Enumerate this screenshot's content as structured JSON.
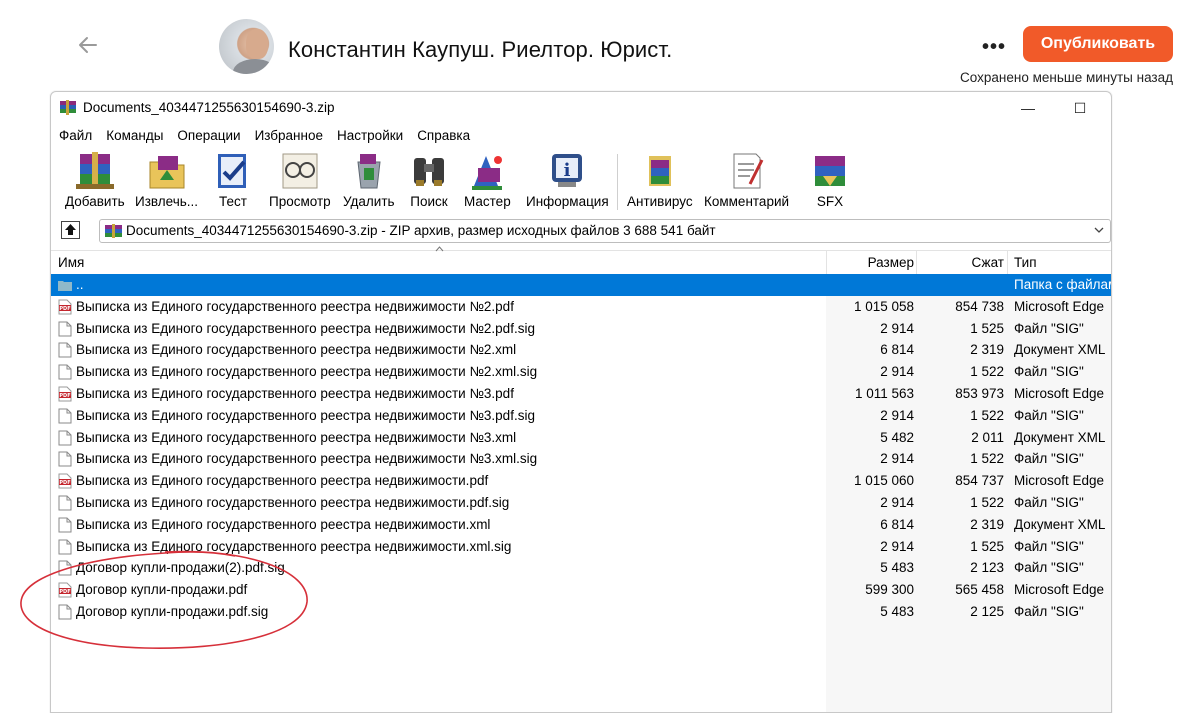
{
  "header": {
    "blog_title": "Константин Каупуш. Риелтор. Юрист.",
    "more_label": "•••",
    "publish_label": "Опубликовать",
    "saved_status": "Сохранено меньше минуты назад"
  },
  "window": {
    "title": "Documents_4034471255630154690-3.zip",
    "controls": {
      "minimize": "—",
      "maximize": "☐",
      "close": "✕"
    },
    "menu": [
      "Файл",
      "Команды",
      "Операции",
      "Избранное",
      "Настройки",
      "Справка"
    ],
    "toolbar": [
      {
        "label": "Добавить",
        "icon": "add-books-icon"
      },
      {
        "label": "Извлечь...",
        "icon": "extract-folder-icon"
      },
      {
        "label": "Тест",
        "icon": "test-check-icon"
      },
      {
        "label": "Просмотр",
        "icon": "view-glasses-icon"
      },
      {
        "label": "Удалить",
        "icon": "delete-recycle-icon"
      },
      {
        "label": "Поиск",
        "icon": "find-binoculars-icon"
      },
      {
        "label": "Мастер",
        "icon": "wizard-icon"
      },
      {
        "label": "Информация",
        "icon": "info-icon"
      },
      {
        "label": "Антивирус",
        "icon": "antivirus-icon"
      },
      {
        "label": "Комментарий",
        "icon": "comment-icon"
      },
      {
        "label": "SFX",
        "icon": "sfx-icon"
      }
    ],
    "path": "Documents_4034471255630154690-3.zip - ZIP архив, размер исходных файлов 3 688 541 байт",
    "columns": {
      "name": "Имя",
      "size": "Размер",
      "packed": "Сжат",
      "type": "Тип"
    },
    "files": [
      {
        "name": "..",
        "size": "",
        "packed": "",
        "type": "Папка с файлам",
        "kind": "folder",
        "selected": true
      },
      {
        "name": "Выписка из Единого государственного реестра недвижимости №2.pdf",
        "size": "1 015 058",
        "packed": "854 738",
        "type": "Microsoft Edge",
        "kind": "pdf"
      },
      {
        "name": "Выписка из Единого государственного реестра недвижимости №2.pdf.sig",
        "size": "2 914",
        "packed": "1 525",
        "type": "Файл \"SIG\"",
        "kind": "file"
      },
      {
        "name": "Выписка из Единого государственного реестра недвижимости №2.xml",
        "size": "6 814",
        "packed": "2 319",
        "type": "Документ XML",
        "kind": "file"
      },
      {
        "name": "Выписка из Единого государственного реестра недвижимости №2.xml.sig",
        "size": "2 914",
        "packed": "1 522",
        "type": "Файл \"SIG\"",
        "kind": "file"
      },
      {
        "name": "Выписка из Единого государственного реестра недвижимости №3.pdf",
        "size": "1 011 563",
        "packed": "853 973",
        "type": "Microsoft Edge",
        "kind": "pdf"
      },
      {
        "name": "Выписка из Единого государственного реестра недвижимости №3.pdf.sig",
        "size": "2 914",
        "packed": "1 522",
        "type": "Файл \"SIG\"",
        "kind": "file"
      },
      {
        "name": "Выписка из Единого государственного реестра недвижимости №3.xml",
        "size": "5 482",
        "packed": "2 011",
        "type": "Документ XML",
        "kind": "file"
      },
      {
        "name": "Выписка из Единого государственного реестра недвижимости №3.xml.sig",
        "size": "2 914",
        "packed": "1 522",
        "type": "Файл \"SIG\"",
        "kind": "file"
      },
      {
        "name": "Выписка из Единого государственного реестра недвижимости.pdf",
        "size": "1 015 060",
        "packed": "854 737",
        "type": "Microsoft Edge",
        "kind": "pdf"
      },
      {
        "name": "Выписка из Единого государственного реестра недвижимости.pdf.sig",
        "size": "2 914",
        "packed": "1 522",
        "type": "Файл \"SIG\"",
        "kind": "file"
      },
      {
        "name": "Выписка из Единого государственного реестра недвижимости.xml",
        "size": "6 814",
        "packed": "2 319",
        "type": "Документ XML",
        "kind": "file"
      },
      {
        "name": "Выписка из Единого государственного реестра недвижимости.xml.sig",
        "size": "2 914",
        "packed": "1 525",
        "type": "Файл \"SIG\"",
        "kind": "file"
      },
      {
        "name": "Договор купли-продажи(2).pdf.sig",
        "size": "5 483",
        "packed": "2 123",
        "type": "Файл \"SIG\"",
        "kind": "file"
      },
      {
        "name": "Договор купли-продажи.pdf",
        "size": "599 300",
        "packed": "565 458",
        "type": "Microsoft Edge",
        "kind": "pdf"
      },
      {
        "name": "Договор купли-продажи.pdf.sig",
        "size": "5 483",
        "packed": "2 125",
        "type": "Файл \"SIG\"",
        "kind": "file"
      }
    ]
  },
  "colors": {
    "accent": "#f15a29",
    "selection": "#0078d7",
    "annotation": "#d6303a"
  }
}
